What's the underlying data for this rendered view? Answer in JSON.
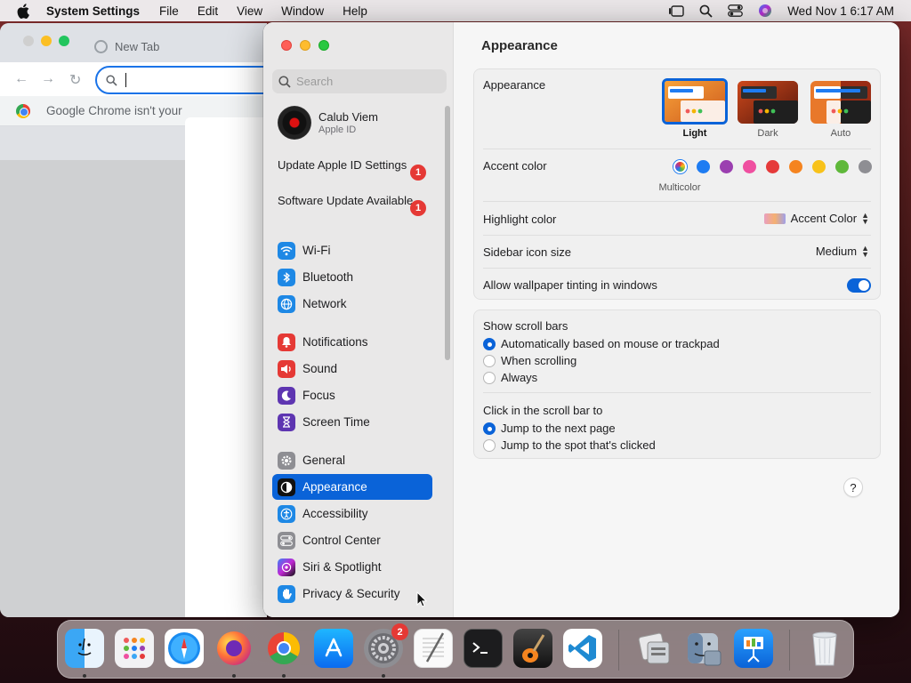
{
  "menubar": {
    "app_name": "System Settings",
    "menus": [
      "File",
      "Edit",
      "View",
      "Window",
      "Help"
    ],
    "clock": "Wed Nov 1  6:17 AM"
  },
  "chrome": {
    "tab_title": "New Tab",
    "infobar_text": "Google Chrome isn't your"
  },
  "sidebar": {
    "search_placeholder": "Search",
    "profile": {
      "name": "Calub Viem",
      "subtitle": "Apple ID"
    },
    "updates": [
      {
        "label": "Update Apple ID Settings",
        "badge": "1"
      },
      {
        "label": "Software Update Available",
        "badge": "1"
      }
    ],
    "items": [
      {
        "label": "Wi-Fi",
        "icon": "wifi-icon",
        "color": "#1e88e5"
      },
      {
        "label": "Bluetooth",
        "icon": "bluetooth-icon",
        "color": "#1e88e5"
      },
      {
        "label": "Network",
        "icon": "globe-icon",
        "color": "#1e88e5"
      },
      {
        "label": "Notifications",
        "icon": "bell-icon",
        "color": "#e53935"
      },
      {
        "label": "Sound",
        "icon": "speaker-icon",
        "color": "#e53935"
      },
      {
        "label": "Focus",
        "icon": "moon-icon",
        "color": "#5e35b1"
      },
      {
        "label": "Screen Time",
        "icon": "hourglass-icon",
        "color": "#5e35b1"
      },
      {
        "label": "General",
        "icon": "gear-icon",
        "color": "#8e8e93"
      },
      {
        "label": "Appearance",
        "icon": "appearance-icon",
        "color": "#111111",
        "active": true
      },
      {
        "label": "Accessibility",
        "icon": "accessibility-icon",
        "color": "#1e88e5"
      },
      {
        "label": "Control Center",
        "icon": "control-center-icon",
        "color": "#8e8e93"
      },
      {
        "label": "Siri & Spotlight",
        "icon": "siri-icon",
        "color": "#7b1fa2"
      },
      {
        "label": "Privacy & Security",
        "icon": "hand-icon",
        "color": "#1e88e5"
      }
    ]
  },
  "main": {
    "title": "Appearance",
    "appearance": {
      "label": "Appearance",
      "options": [
        "Light",
        "Dark",
        "Auto"
      ],
      "selected": "Light"
    },
    "accent": {
      "label": "Accent color",
      "selected_name": "Multicolor",
      "colors": [
        "multicolor",
        "#1e7cf2",
        "#9b3fb0",
        "#ef4fa0",
        "#e53a3a",
        "#f5841f",
        "#f8c21a",
        "#5fb83a",
        "#8e8e93"
      ]
    },
    "highlight": {
      "label": "Highlight color",
      "value": "Accent Color"
    },
    "icon_size": {
      "label": "Sidebar icon size",
      "value": "Medium"
    },
    "tinting": {
      "label": "Allow wallpaper tinting in windows",
      "on": true
    },
    "scroll_bars": {
      "label": "Show scroll bars",
      "options": [
        "Automatically based on mouse or trackpad",
        "When scrolling",
        "Always"
      ],
      "selected": 0
    },
    "click_scroll": {
      "label": "Click in the scroll bar to",
      "options": [
        "Jump to the next page",
        "Jump to the spot that's clicked"
      ],
      "selected": 0
    },
    "help": "?"
  },
  "dock": {
    "settings_badge": "2",
    "apps": [
      "finder-icon",
      "launchpad-icon",
      "safari-icon",
      "firefox-icon",
      "chrome-icon",
      "app-store-icon",
      "system-settings-icon",
      "textedit-icon",
      "terminal-icon",
      "garageband-icon",
      "vscode-icon",
      "utility-icon",
      "finder-alt-icon",
      "keynote-icon",
      "trash-icon"
    ]
  }
}
